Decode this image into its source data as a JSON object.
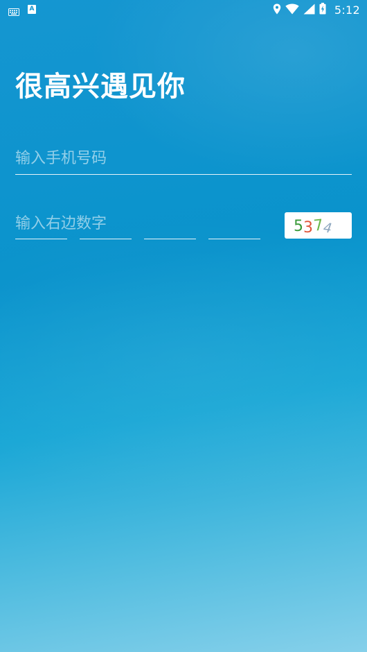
{
  "status_bar": {
    "time": "5:12",
    "notification_icons": [
      "keyboard-icon",
      "a-icon"
    ],
    "a_label": "A",
    "system_icons": [
      "location-icon",
      "wifi-icon",
      "signal-icon",
      "battery-icon"
    ]
  },
  "page": {
    "title": "很高兴遇见你"
  },
  "form": {
    "phone_placeholder": "输入手机号码",
    "phone_value": "",
    "captcha_hint": "输入右边数字",
    "digit_inputs": [
      "",
      "",
      "",
      ""
    ],
    "captcha": {
      "digits": [
        "5",
        "3",
        "7",
        "4"
      ],
      "colors": [
        "#3a9a3a",
        "#e0563a",
        "#6bb84a",
        "#8fa8c0"
      ]
    }
  },
  "colors": {
    "background_top": "#1596d1",
    "background_bottom": "#86d0ea",
    "text": "#ffffff"
  }
}
